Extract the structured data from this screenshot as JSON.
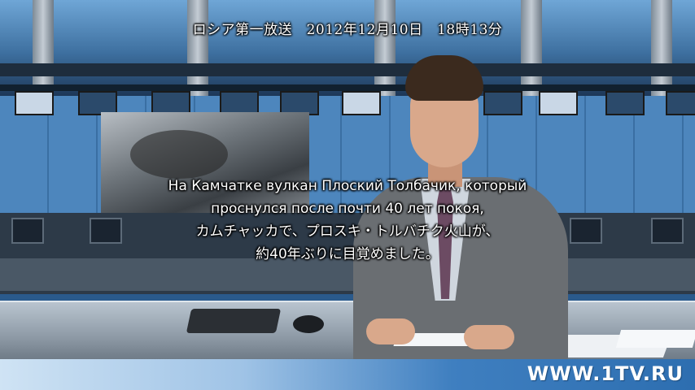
{
  "overlay": {
    "channel_date": "ロシア第一放送　2012年12月10日　18時13分"
  },
  "subtitles": {
    "line_1": "На Камчатке вулкан Плоский Толбачик, который",
    "line_2": "проснулся после почти 40 лет покоя,",
    "line_3": "カムチャッカで、プロスキ・トルバチク火山が、",
    "line_4": "約40年ぶりに目覚めました。"
  },
  "footer": {
    "logo_text": "WWW.1TV.RU"
  },
  "colors": {
    "studio_blue": "#3f78ae",
    "footer_blue": "#2d6eb0",
    "text_white": "#ffffff"
  }
}
